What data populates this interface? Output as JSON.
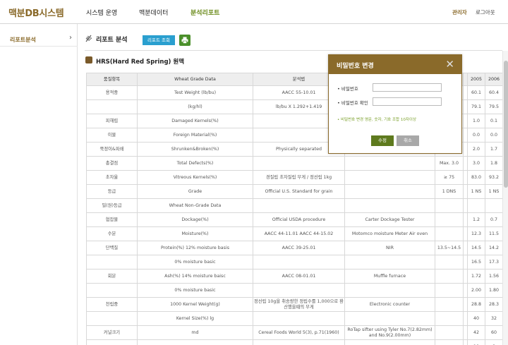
{
  "app": {
    "logo": "맥분DB시스템",
    "nav": [
      "시스템 운영",
      "맥분데이터",
      "분석리포트"
    ],
    "admin": "관리자",
    "logout": "로그아웃"
  },
  "sidebar": {
    "item": "리포트분석",
    "chevron": "›"
  },
  "main": {
    "title": "리포트 분석",
    "report_button": "리포트 조회",
    "print_icon": "printer-icon",
    "section_title": "HRS(Hard Red Spring) 원맥"
  },
  "table": {
    "headers": [
      "품질항목",
      "Wheat Grade Data",
      "분석법",
      "",
      "",
      "",
      "2005",
      "2006"
    ],
    "rows": [
      [
        "용적중",
        "Test Weight (lb/bu)",
        "AACC 55-10.01",
        "",
        "",
        "",
        "60.1",
        "60.4"
      ],
      [
        "",
        "(kg/hl)",
        "lb/bu X 1.292+1.419",
        "",
        "",
        "",
        "79.1",
        "79.5"
      ],
      [
        "피해립",
        "Damaged Kernels(%)",
        "",
        "",
        "",
        "",
        "1.0",
        "0.1"
      ],
      [
        "이물",
        "Foreign Material(%)",
        "",
        "",
        "",
        "",
        "0.0",
        "0.0"
      ],
      [
        "쭉정이&파쇄",
        "Shrunken&Broken(%)",
        "Physically separated",
        "",
        "",
        "",
        "2.0",
        "1.7"
      ],
      [
        "총결점",
        "Total Defects(%)",
        "",
        "",
        "Max. 3.0",
        "",
        "3.0",
        "1.8"
      ],
      [
        "초자율",
        "Vitreous Kernels(%)",
        "경질립 초자질립 무게 / 정선립 1kg",
        "",
        "≥ 75",
        "",
        "83.0",
        "93.2"
      ],
      [
        "등급",
        "Grade",
        "Official U.S. Standard for grain",
        "",
        "1 DNS",
        "",
        "1 NS",
        "1 NS"
      ],
      [
        "밀(원)등급",
        "Wheat Non-Grade Data",
        "",
        "",
        "",
        "",
        "",
        ""
      ],
      [
        "협잡물",
        "Dockage(%)",
        "Official USDA procedure",
        "Carter Dockage Tester",
        "",
        "",
        "1.2",
        "0.7"
      ],
      [
        "수분",
        "Moisture(%)",
        "AACC 44-11.01 AACC 44-15.02",
        "Motomco moisture Meter Air oven",
        "",
        "",
        "12.3",
        "11.5"
      ],
      [
        "단백질",
        "Protein(%) 12% moisture basis",
        "AACC 39-25.01",
        "NIR",
        "13.5~14.5",
        "",
        "14.5",
        "14.2"
      ],
      [
        "",
        "0% moisture basic",
        "",
        "",
        "",
        "",
        "16.5",
        "17.3"
      ],
      [
        "회분",
        "Ash(%) 14% moisture baisc",
        "AACC 08-01.01",
        "Muffle furnace",
        "",
        "",
        "1.72",
        "1.56"
      ],
      [
        "",
        "0% moisture basic",
        "",
        "",
        "",
        "",
        "2.00",
        "1.80"
      ],
      [
        "천립중",
        "1000 Kernel Weight(g)",
        "정선립 10g을 취송량한 정립수를 1,000으로 환산했을때의 무게",
        "Electronic counter",
        "",
        "",
        "28.8",
        "28.3"
      ],
      [
        "",
        "Kernel Size(%) lg",
        "",
        "",
        "",
        "",
        "40",
        "32"
      ],
      [
        "커널크기",
        "md",
        "Cereal Foods World 5(3), p.71(1960)",
        "RoTap sifter using Tyler No.7(2.82mm) and No.9(2.00mm)",
        "",
        "",
        "42",
        "60"
      ],
      [
        "",
        "sm",
        "",
        "",
        "",
        "",
        "10",
        "8"
      ]
    ]
  },
  "modal": {
    "title": "비밀번호 변경",
    "close_icon": "close-icon",
    "label_password": "• 비밀번호",
    "label_confirm": "• 비밀번호 확인",
    "note": "• 비밀번호 변경 영문, 숫자, 기호 조합 10자이상",
    "confirm": "수정",
    "cancel": "취소"
  }
}
